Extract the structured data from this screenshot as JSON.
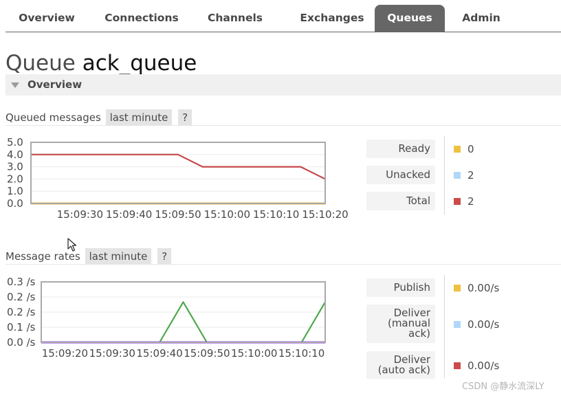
{
  "nav": {
    "tabs": [
      {
        "label": "Overview",
        "active": false
      },
      {
        "label": "Connections",
        "active": false
      },
      {
        "label": "Channels",
        "active": false
      },
      {
        "label": "Exchanges",
        "active": false
      },
      {
        "label": "Queues",
        "active": true
      },
      {
        "label": "Admin",
        "active": false
      }
    ]
  },
  "page": {
    "title_prefix": "Queue",
    "queue_name": "ack_queue",
    "section_label": "Overview"
  },
  "queued": {
    "heading": "Queued messages",
    "range": "last minute",
    "help": "?",
    "legend": [
      {
        "label": "Ready",
        "value": "0",
        "color": "#EDC240"
      },
      {
        "label": "Unacked",
        "value": "2",
        "color": "#AFD8F8"
      },
      {
        "label": "Total",
        "value": "2",
        "color": "#CB4B4B"
      }
    ]
  },
  "rates": {
    "heading": "Message rates",
    "range": "last minute",
    "help": "?",
    "legend": [
      {
        "label": "Publish",
        "value": "0.00/s",
        "color": "#EDC240"
      },
      {
        "label": "Deliver (manual ack)",
        "value": "0.00/s",
        "color": "#AFD8F8"
      },
      {
        "label": "Deliver (auto ack)",
        "value": "0.00/s",
        "color": "#CB4B4B"
      }
    ]
  },
  "watermark": "CSDN @静水流深LY",
  "chart_data": [
    {
      "type": "line",
      "title": "Queued messages",
      "x": [
        "15:09:20",
        "15:09:25",
        "15:09:30",
        "15:09:35",
        "15:09:40",
        "15:09:45",
        "15:09:50",
        "15:09:55",
        "15:10:00",
        "15:10:05",
        "15:10:10",
        "15:10:15",
        "15:10:20"
      ],
      "x_tick_labels": [
        "15:09:30",
        "15:09:40",
        "15:09:50",
        "15:10:00",
        "15:10:10",
        "15:10:20"
      ],
      "ylim": [
        0,
        5
      ],
      "y_tick_labels": [
        "0.0",
        "1.0",
        "2.0",
        "3.0",
        "4.0",
        "5.0"
      ],
      "grid": true,
      "series": [
        {
          "name": "Ready",
          "color": "#EDC240",
          "values": [
            0,
            0,
            0,
            0,
            0,
            0,
            0,
            0,
            0,
            0,
            0,
            0,
            0
          ]
        },
        {
          "name": "Unacked",
          "color": "#AFD8F8",
          "values": [
            4,
            4,
            4,
            4,
            4,
            4,
            4,
            3,
            3,
            3,
            3,
            3,
            2
          ]
        },
        {
          "name": "Total",
          "color": "#CB4B4B",
          "values": [
            4,
            4,
            4,
            4,
            4,
            4,
            4,
            3,
            3,
            3,
            3,
            3,
            2
          ]
        }
      ]
    },
    {
      "type": "line",
      "title": "Message rates",
      "x": [
        "15:09:15",
        "15:09:20",
        "15:09:25",
        "15:09:30",
        "15:09:35",
        "15:09:40",
        "15:09:45",
        "15:09:50",
        "15:09:55",
        "15:10:00",
        "15:10:05",
        "15:10:10",
        "15:10:15"
      ],
      "x_tick_labels": [
        "15:09:20",
        "15:09:30",
        "15:09:40",
        "15:09:50",
        "15:10:00",
        "15:10:10"
      ],
      "ylim": [
        0,
        0.3
      ],
      "y_tick_labels": [
        "0.0 /s",
        "0.1 /s",
        "0.2 /s",
        "0.2 /s",
        "0.3 /s"
      ],
      "grid": true,
      "series": [
        {
          "name": "Publish",
          "color": "#EDC240",
          "values": [
            0,
            0,
            0,
            0,
            0,
            0,
            0,
            0,
            0,
            0,
            0,
            0,
            0
          ]
        },
        {
          "name": "Deliver (manual ack)",
          "color": "#AFD8F8",
          "values": [
            0,
            0,
            0,
            0,
            0,
            0,
            0,
            0,
            0,
            0,
            0,
            0,
            0
          ]
        },
        {
          "name": "Deliver (auto ack)",
          "color": "#CB4B4B",
          "values": [
            0,
            0,
            0,
            0,
            0,
            0,
            0,
            0,
            0,
            0,
            0,
            0,
            0
          ]
        },
        {
          "name": "",
          "color": "#4DA74D",
          "values": [
            0,
            0,
            0,
            0,
            0,
            0,
            0.2,
            0,
            0,
            0,
            0,
            0,
            0.2
          ]
        },
        {
          "name": "",
          "color": "#9440ED",
          "values": [
            0,
            0,
            0,
            0,
            0,
            0,
            0,
            0,
            0,
            0,
            0,
            0,
            0
          ]
        }
      ]
    }
  ]
}
